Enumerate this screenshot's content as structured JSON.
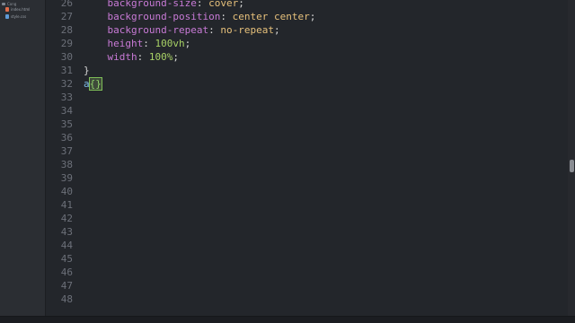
{
  "sidebar": {
    "folder_label": "Cong",
    "files": [
      {
        "name": "index.html",
        "type": "html"
      },
      {
        "name": "style.css",
        "type": "css"
      }
    ]
  },
  "editor": {
    "lines": [
      {
        "n": "26",
        "prop": "background-size",
        "value": "cover"
      },
      {
        "n": "27",
        "prop": "background-position",
        "value": "center center"
      },
      {
        "n": "28",
        "prop": "background-repeat",
        "value": "no-repeat"
      },
      {
        "n": "29",
        "prop": "height",
        "num": "100",
        "unit": "vh"
      },
      {
        "n": "30",
        "prop": "width",
        "num": "100",
        "unit": "%"
      },
      {
        "n": "31",
        "text": "}"
      },
      {
        "n": "32",
        "selector": "a",
        "bracket": "{}"
      },
      {
        "n": "33"
      },
      {
        "n": "34"
      },
      {
        "n": "35"
      },
      {
        "n": "36"
      },
      {
        "n": "37"
      },
      {
        "n": "38"
      },
      {
        "n": "39"
      },
      {
        "n": "40"
      },
      {
        "n": "41"
      },
      {
        "n": "42"
      },
      {
        "n": "43"
      },
      {
        "n": "44"
      },
      {
        "n": "45"
      },
      {
        "n": "46"
      },
      {
        "n": "47"
      },
      {
        "n": "48"
      }
    ]
  },
  "statusbar": {
    "left": "",
    "right": []
  }
}
